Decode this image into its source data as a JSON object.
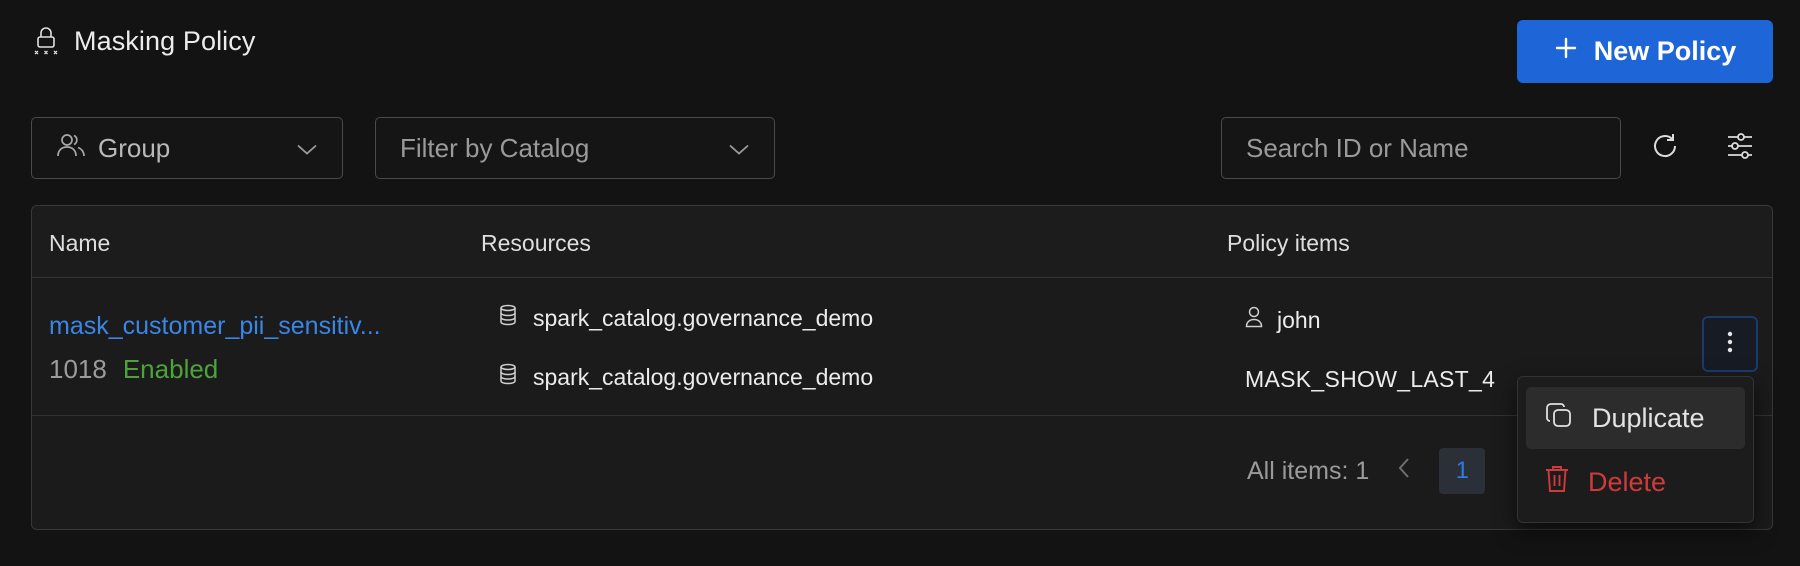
{
  "header": {
    "title": "Masking Policy",
    "new_button": "New Policy"
  },
  "filters": {
    "group_label": "Group",
    "catalog_placeholder": "Filter by Catalog",
    "search_placeholder": "Search ID or Name"
  },
  "table": {
    "columns": [
      "Name",
      "Resources",
      "Policy items"
    ],
    "rows": [
      {
        "name": "mask_customer_pii_sensitiv...",
        "id": "1018",
        "status": "Enabled",
        "resources": [
          "spark_catalog.governance_demo",
          "spark_catalog.governance_demo"
        ],
        "policy_user": "john",
        "policy_mask": "MASK_SHOW_LAST_4"
      }
    ]
  },
  "pagination": {
    "label": "All items: 1",
    "current_page": "1"
  },
  "row_menu": {
    "duplicate": "Duplicate",
    "delete": "Delete"
  },
  "colors": {
    "accent": "#1e66d8",
    "link": "#3a86e6",
    "enabled": "#4ca33a",
    "danger": "#d03a3a"
  }
}
